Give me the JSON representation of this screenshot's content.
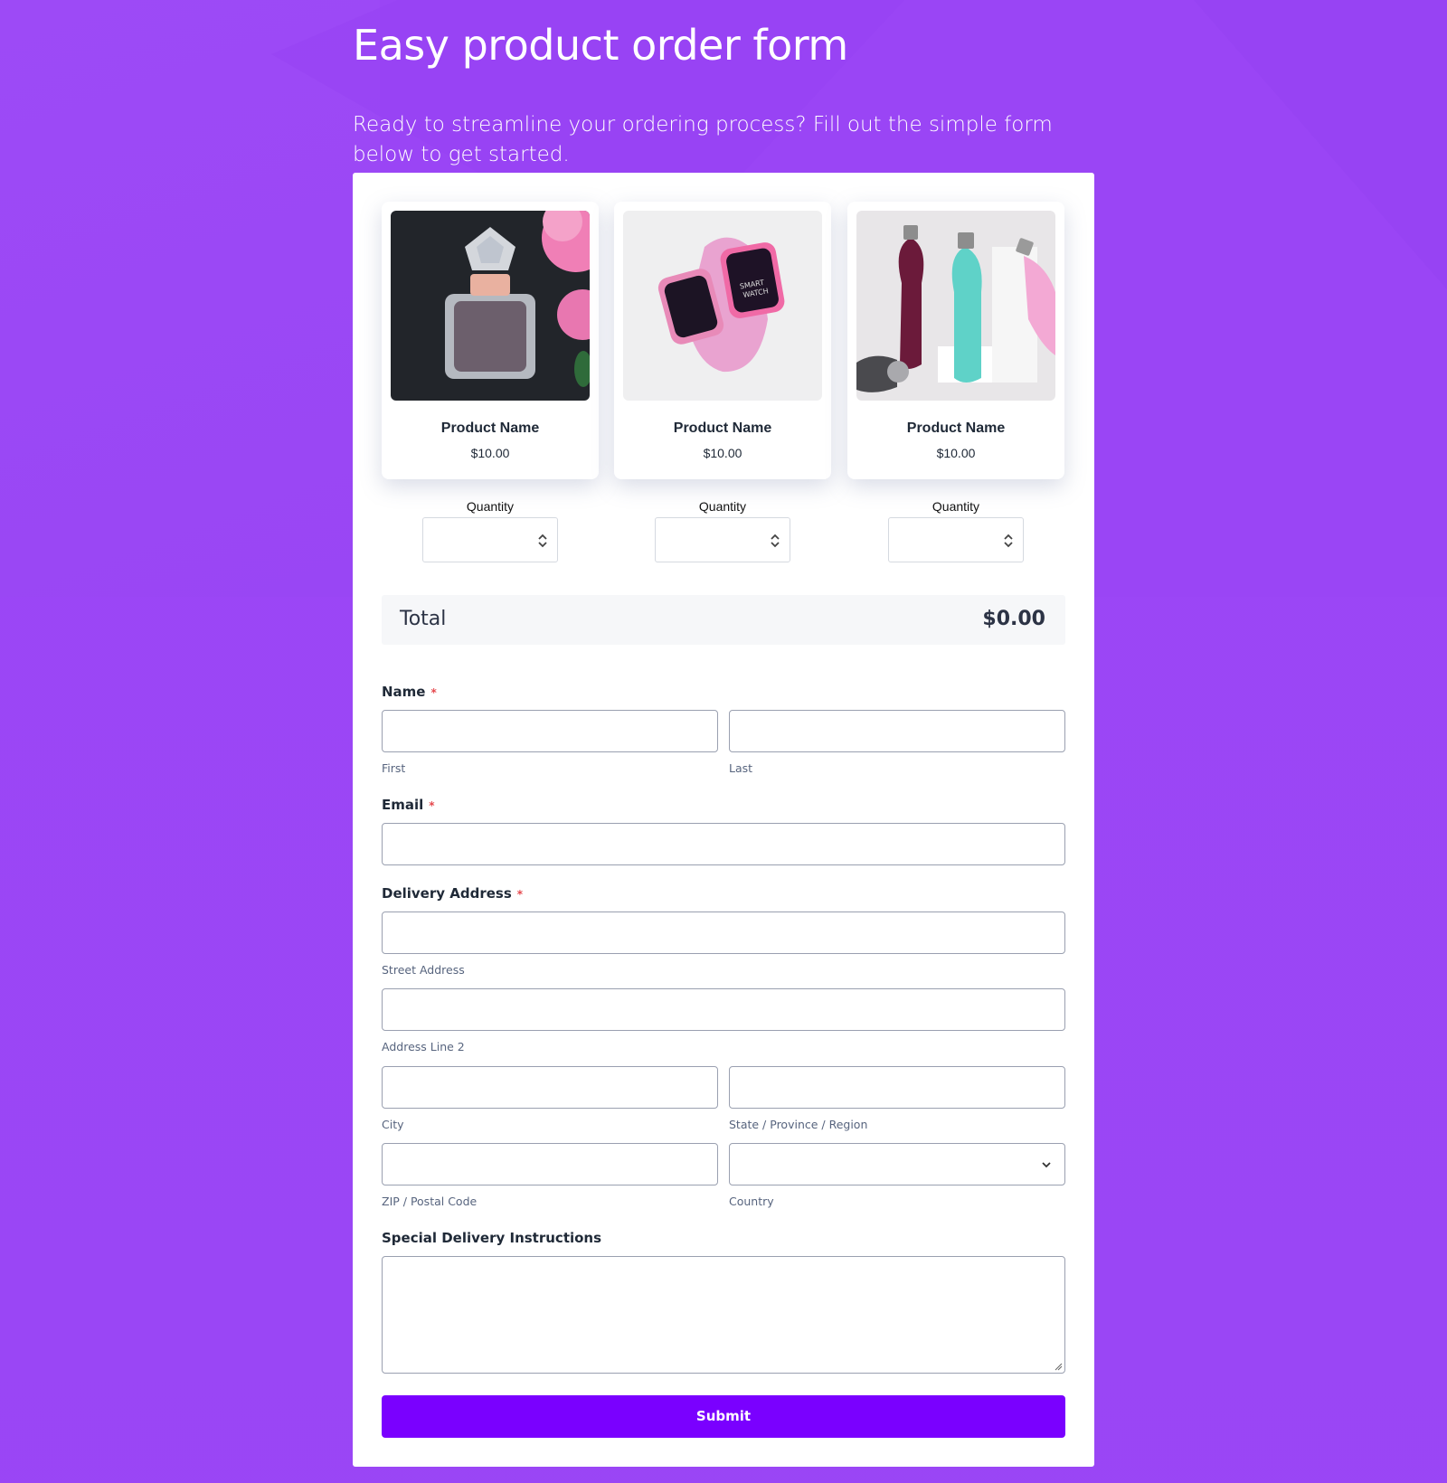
{
  "header": {
    "title": "Easy product order form",
    "intro": "Ready to streamline your ordering process? Fill out the simple form below to get started."
  },
  "products": [
    {
      "name": "Product Name",
      "price": "$10.00",
      "quantity_label": "Quantity",
      "image": "perfume-bottle-image"
    },
    {
      "name": "Product Name",
      "price": "$10.00",
      "quantity_label": "Quantity",
      "image": "smart-watch-image"
    },
    {
      "name": "Product Name",
      "price": "$10.00",
      "quantity_label": "Quantity",
      "image": "water-bottles-image"
    }
  ],
  "total": {
    "label": "Total",
    "value": "$0.00"
  },
  "form": {
    "name": {
      "label": "Name",
      "required_mark": "*",
      "first_sub": "First",
      "last_sub": "Last"
    },
    "email": {
      "label": "Email",
      "required_mark": "*"
    },
    "address": {
      "label": "Delivery Address",
      "required_mark": "*",
      "street_sub": "Street Address",
      "line2_sub": "Address Line 2",
      "city_sub": "City",
      "state_sub": "State / Province / Region",
      "zip_sub": "ZIP / Postal Code",
      "country_sub": "Country"
    },
    "instructions": {
      "label": "Special Delivery Instructions"
    },
    "submit_label": "Submit"
  },
  "colors": {
    "background": "#9a45f5",
    "submit": "#7a00ff",
    "required": "#e5484d"
  }
}
